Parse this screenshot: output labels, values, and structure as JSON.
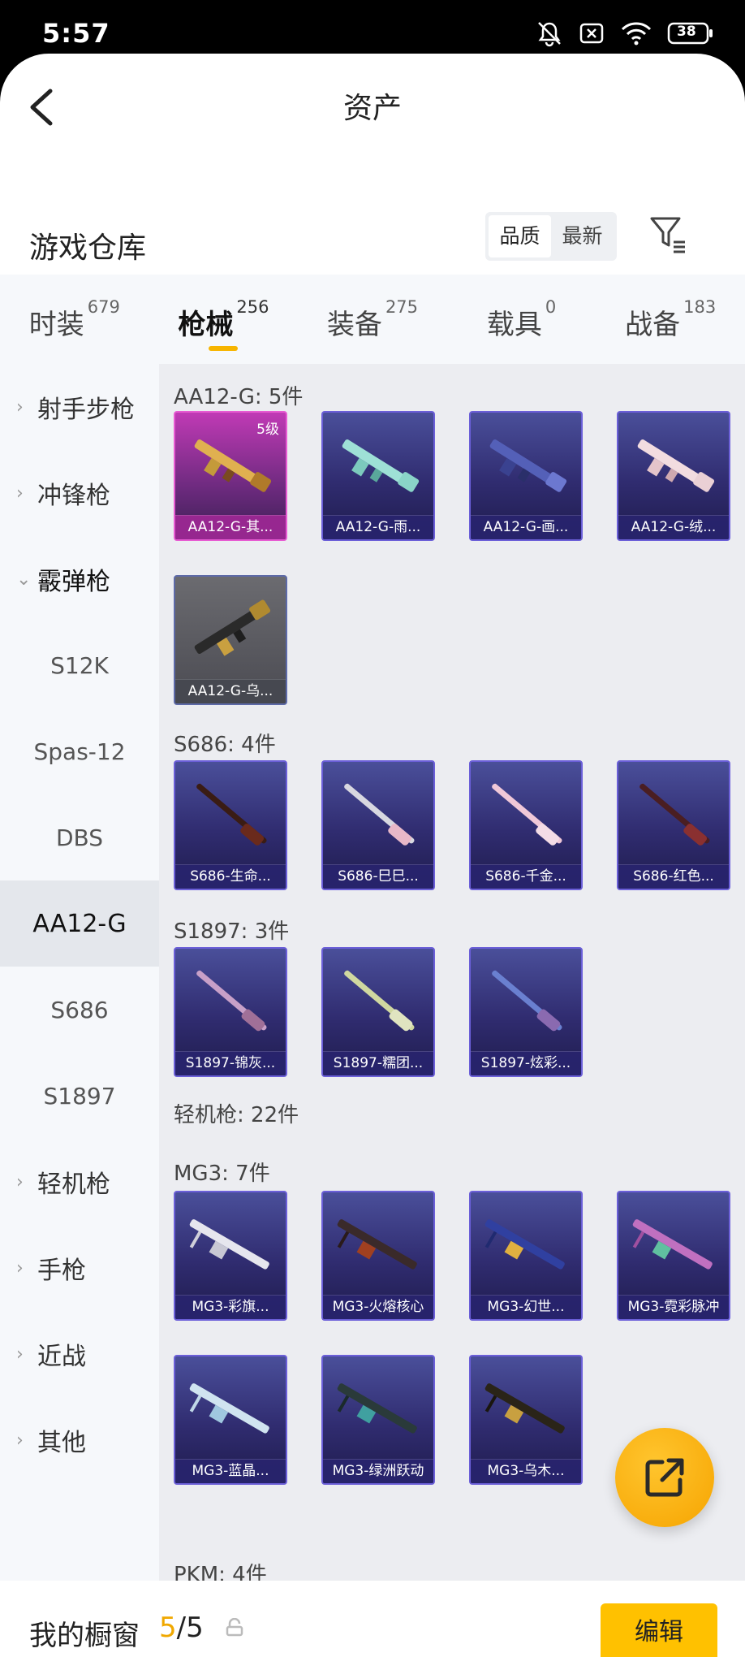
{
  "status_bar": {
    "time": "5:57",
    "battery": "38"
  },
  "header": {
    "title": "资产"
  },
  "warehouse": {
    "title": "游戏仓库",
    "sort_options": [
      "品质",
      "最新"
    ],
    "sort_selected": "品质"
  },
  "categories": [
    {
      "label": "时装",
      "count": "679"
    },
    {
      "label": "枪械",
      "count": "256",
      "active": true
    },
    {
      "label": "装备",
      "count": "275"
    },
    {
      "label": "载具",
      "count": "0"
    },
    {
      "label": "战备",
      "count": "183"
    }
  ],
  "sidebar": {
    "items": [
      {
        "label": "射手步枪",
        "type": "group"
      },
      {
        "label": "冲锋枪",
        "type": "group"
      },
      {
        "label": "霰弹枪",
        "type": "group-open"
      },
      {
        "label": "S12K",
        "type": "sub"
      },
      {
        "label": "Spas-12",
        "type": "sub"
      },
      {
        "label": "DBS",
        "type": "sub"
      },
      {
        "label": "AA12-G",
        "type": "sub-selected"
      },
      {
        "label": "S686",
        "type": "sub"
      },
      {
        "label": "S1897",
        "type": "sub"
      },
      {
        "label": "轻机枪",
        "type": "group"
      },
      {
        "label": "手枪",
        "type": "group"
      },
      {
        "label": "近战",
        "type": "group"
      },
      {
        "label": "其他",
        "type": "group"
      }
    ]
  },
  "groups": [
    {
      "header": "AA12-G: 5件",
      "items": [
        {
          "name": "AA12-G-其...",
          "level": "5级"
        },
        {
          "name": "AA12-G-雨..."
        },
        {
          "name": "AA12-G-画..."
        },
        {
          "name": "AA12-G-绒..."
        },
        {
          "name": "AA12-G-乌..."
        }
      ]
    },
    {
      "header": "S686: 4件",
      "items": [
        {
          "name": "S686-生命..."
        },
        {
          "name": "S686-巳巳..."
        },
        {
          "name": "S686-千金..."
        },
        {
          "name": "S686-红色..."
        }
      ]
    },
    {
      "header": "S1897: 3件",
      "items": [
        {
          "name": "S1897-锦灰..."
        },
        {
          "name": "S1897-糯团..."
        },
        {
          "name": "S1897-炫彩..."
        }
      ]
    },
    {
      "header": "轻机枪: 22件",
      "items": []
    },
    {
      "header": "MG3: 7件",
      "items": [
        {
          "name": "MG3-彩旗..."
        },
        {
          "name": "MG3-火熔核心"
        },
        {
          "name": "MG3-幻世..."
        },
        {
          "name": "MG3-霓彩脉冲"
        },
        {
          "name": "MG3-蓝晶..."
        },
        {
          "name": "MG3-绿洲跃动"
        },
        {
          "name": "MG3-乌木..."
        }
      ]
    },
    {
      "header": "PKM: 4件",
      "items": []
    }
  ],
  "showcase": {
    "label": "我的橱窗",
    "current": "5",
    "total": "/5",
    "edit_label": "编辑"
  },
  "colors": {
    "accent": "#ffc100",
    "card_border": "#6b5fd8",
    "legendary": "#e75bd2"
  }
}
